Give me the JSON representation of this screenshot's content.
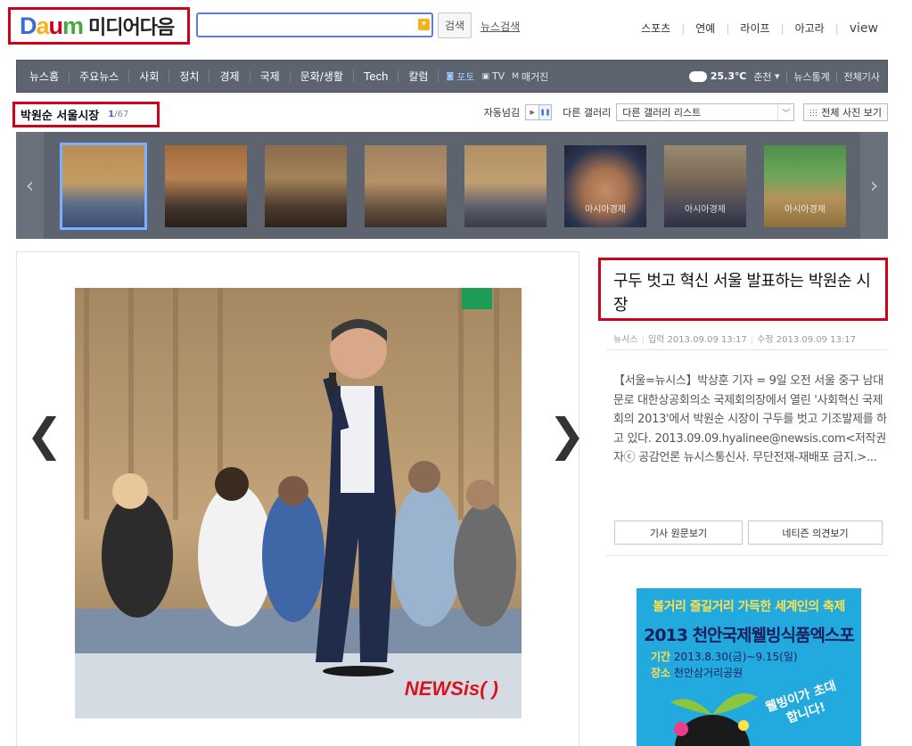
{
  "header": {
    "logo_brand": "Daum",
    "logo_text": "미디어다음",
    "search_button": "검색",
    "news_search": "뉴스검색",
    "top_links": [
      "스포츠",
      "연예",
      "라이프",
      "아고라",
      "view"
    ]
  },
  "nav": {
    "items": [
      "뉴스홈",
      "주요뉴스",
      "사회",
      "정치",
      "경제",
      "국제",
      "문화/생활",
      "Tech",
      "칼럼"
    ],
    "media": [
      "포토",
      "TV",
      "매거진"
    ],
    "weather_temp": "25.3℃",
    "weather_city": "춘천",
    "stats": "뉴스통계",
    "all_articles": "전체기사"
  },
  "gallery": {
    "title": "박원순 서울시장",
    "current": "1",
    "total": "/67",
    "auto_label": "자동넘김",
    "other_label": "다른 갤러리",
    "select_value": "다른 갤러리 리스트",
    "all_photos": "전체 사진 보기",
    "thumbnails": [
      {
        "watermark": "",
        "selected": true
      },
      {
        "watermark": "",
        "selected": false
      },
      {
        "watermark": "",
        "selected": false
      },
      {
        "watermark": "",
        "selected": false
      },
      {
        "watermark": "",
        "selected": false
      },
      {
        "watermark": "아시아경제",
        "selected": false
      },
      {
        "watermark": "아시아경제",
        "selected": false
      },
      {
        "watermark": "아시아경제",
        "selected": false
      }
    ]
  },
  "photo": {
    "watermark": "NEWSis( )"
  },
  "article": {
    "headline": "구두 벗고 혁신 서울 발표하는 박원순 시장",
    "source": "뉴시스",
    "input_time": "입력 2013.09.09 13:17",
    "edit_time": "수정 2013.09.09 13:17",
    "body": "【서울=뉴시스】박상훈 기자 = 9일 오전 서울 중구 남대문로 대한상공회의소 국제회의장에서 열린 '사회혁신 국제회의 2013'에서 박원순 시장이 구두를 벗고 기조발제를 하고 있다. 2013.09.09.hyalinee@newsis.com<저작권자ⓒ 공감언론 뉴시스통신사. 무단전재-재배포 금지.>...",
    "btn_original": "기사 원문보기",
    "btn_opinion": "네티즌 의견보기"
  },
  "ad": {
    "line1": "볼거리 즐길거리 가득한 세계인의 축제",
    "line2": "2013 천안국제웰빙식품엑스포",
    "period_label": "기간",
    "period": "2013.8.30(금)~9.15(일)",
    "place_label": "장소",
    "place": "천안삼거리공원",
    "bubble": "웰빙이가 초대합니다!"
  },
  "colors": {
    "highlight_border": "#d0021b",
    "nav_bg": "#5d6470",
    "link_blue": "#3d6bd4",
    "ad_bg": "#22a9dd"
  }
}
